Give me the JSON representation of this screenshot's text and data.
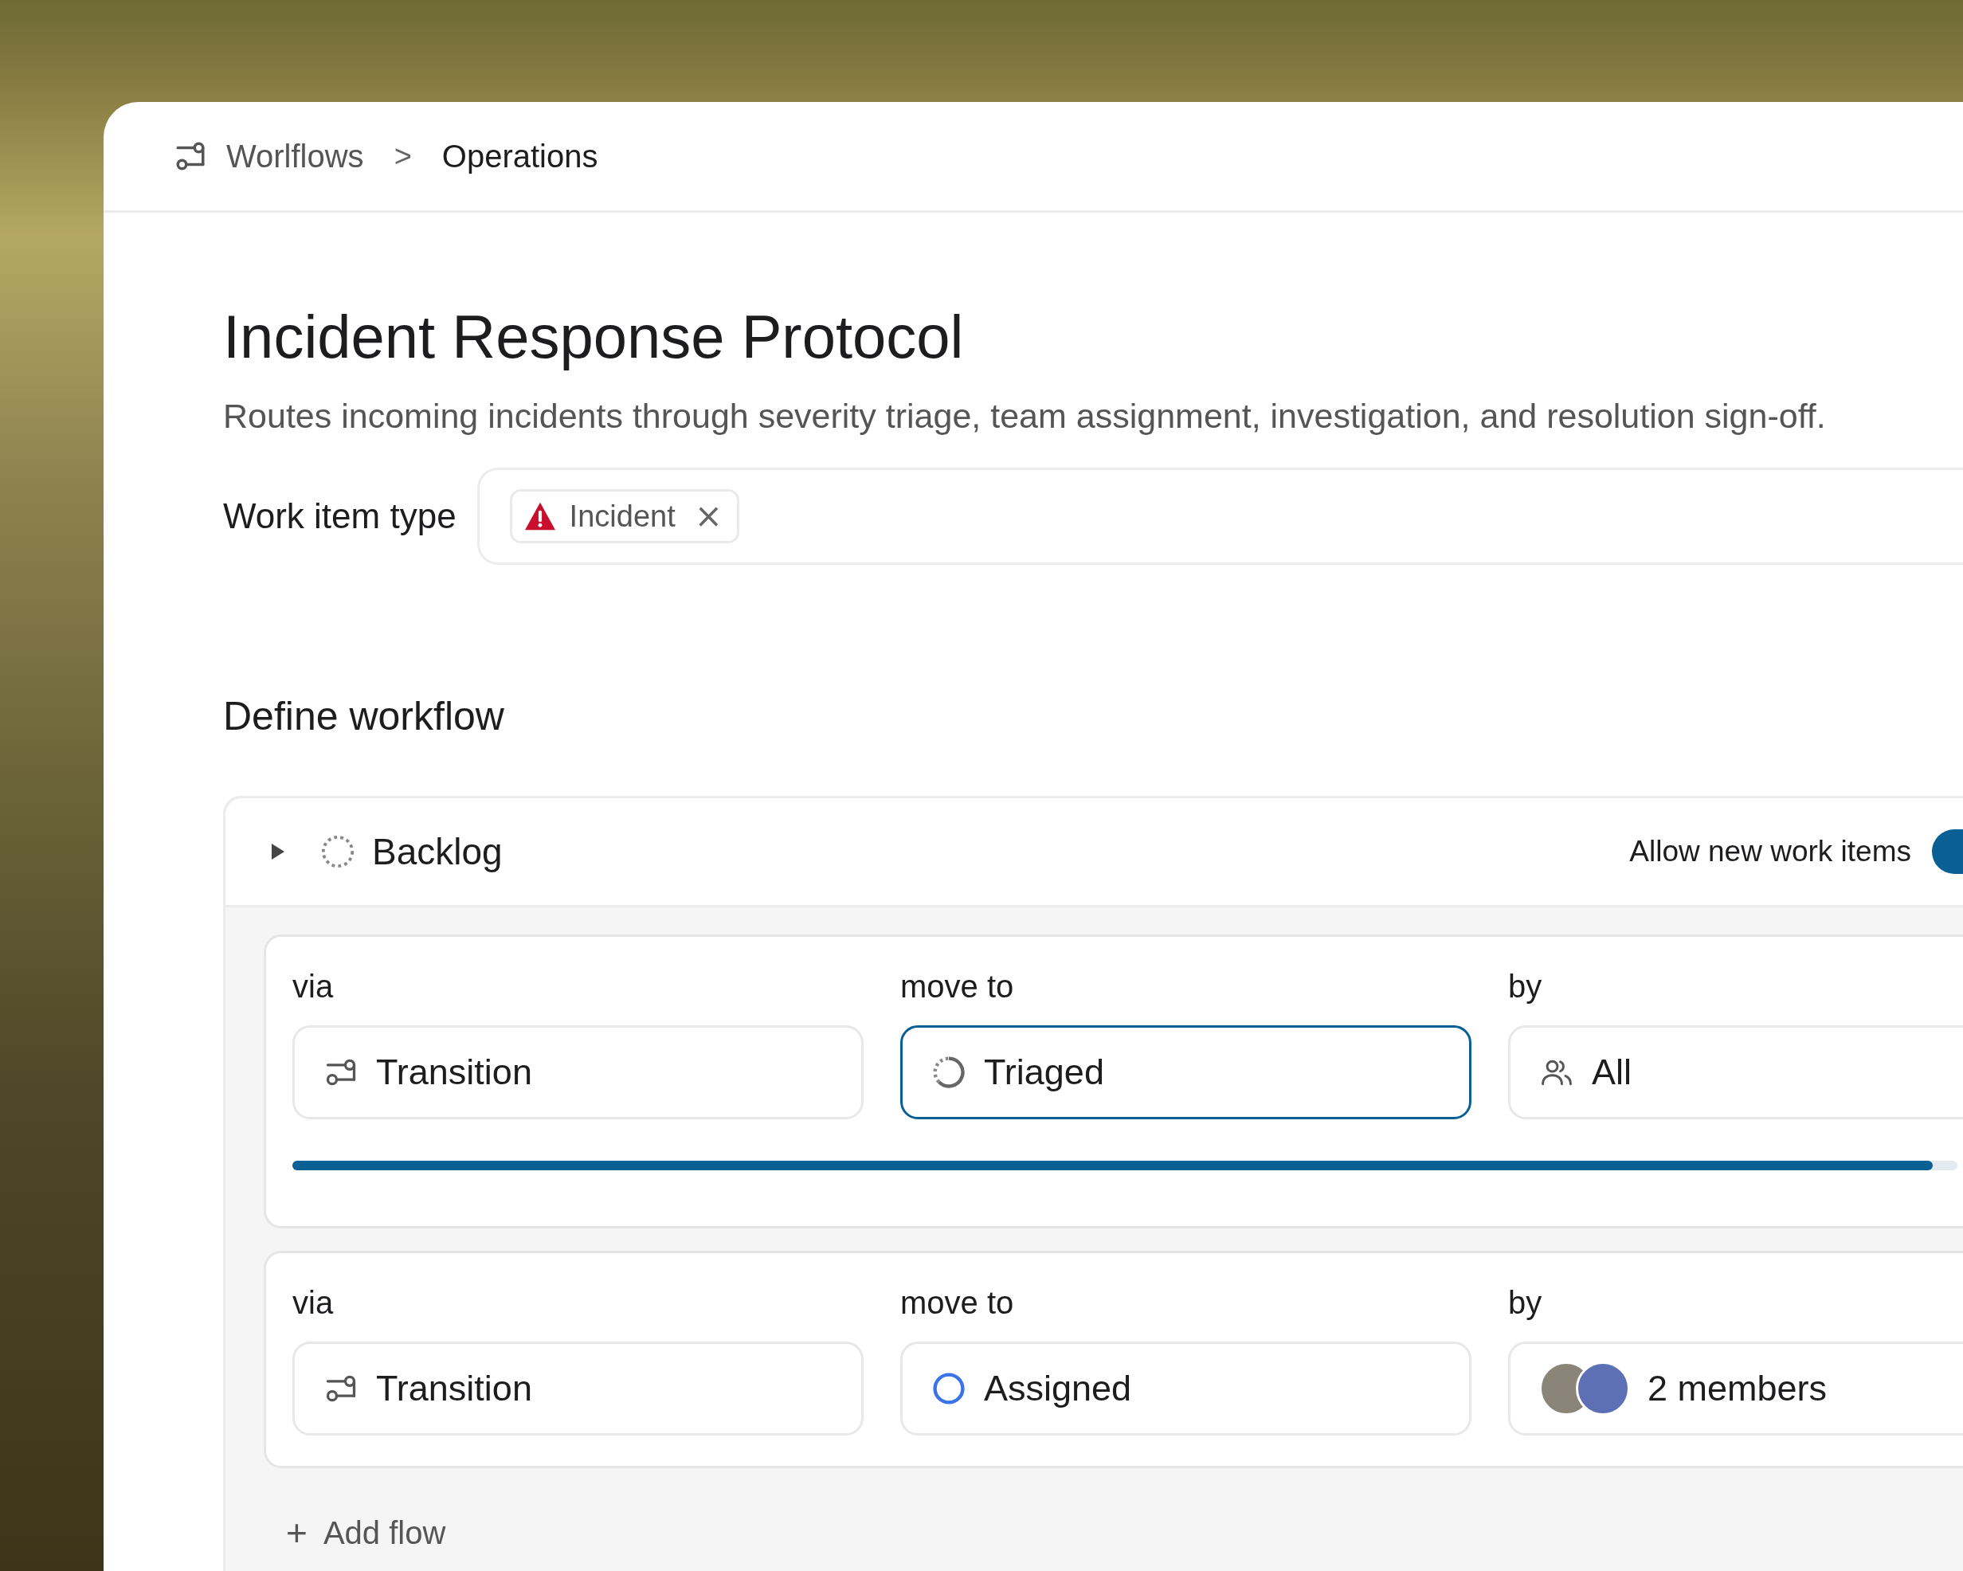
{
  "breadcrumb": {
    "items": [
      {
        "label": "Worlflows",
        "current": false
      },
      {
        "label": "Operations",
        "current": true
      }
    ],
    "separator": ">"
  },
  "title": "Incident Response Protocol",
  "description": "Routes incoming incidents through severity triage, team assignment, investigation, and resolution sign-off.",
  "work_item_type": {
    "label": "Work item type",
    "tags": [
      {
        "label": "Incident",
        "remove": "×"
      }
    ]
  },
  "define_workflow": {
    "heading": "Define workflow"
  },
  "states": [
    {
      "name": "Backlog",
      "kind": "backlog",
      "expanded": false,
      "allow_new_items": {
        "label": "Allow new work items",
        "on": true
      },
      "flows": [
        {
          "via": {
            "label": "via",
            "value": "Transition"
          },
          "move_to": {
            "label": "move to",
            "value": "Triaged",
            "kind": "triaged",
            "focused": true
          },
          "by": {
            "label": "by",
            "value": "All",
            "kind": "all"
          },
          "progress": {
            "level": 0.985
          }
        },
        {
          "via": {
            "label": "via",
            "value": "Transition"
          },
          "move_to": {
            "label": "move to",
            "value": "Assigned",
            "kind": "unstarted",
            "focused": false
          },
          "by": {
            "label": "by",
            "value": "2 members",
            "kind": "members"
          }
        }
      ],
      "add_flow": {
        "icon": "+",
        "label": "Add flow"
      }
    }
  ]
}
